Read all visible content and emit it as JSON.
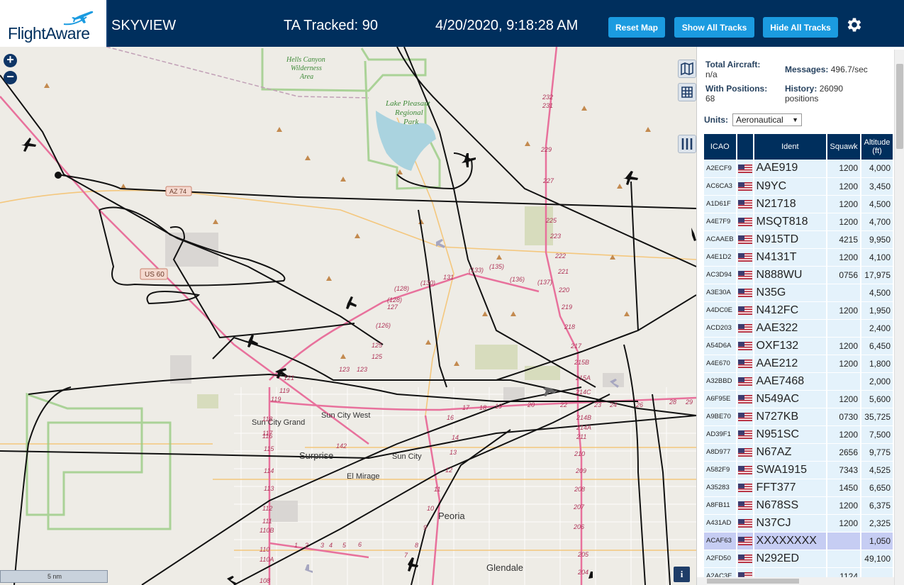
{
  "header": {
    "logo_text": "FlightAware",
    "site_name": "SKYVIEW",
    "tracked": "TA Tracked: 90",
    "datetime": "4/20/2020, 9:18:28 AM",
    "buttons": {
      "reset": "Reset Map",
      "show_all": "Show All Tracks",
      "hide_all": "Hide All Tracks"
    },
    "settings_icon": "gear-icon"
  },
  "map": {
    "zoom_in": "+",
    "zoom_out": "−",
    "scale_label": "5 nm",
    "info_label": "i",
    "places": {
      "hells_canyon": "Hells Canyon",
      "wilderness": "Wilderness",
      "area": "Area",
      "lake_pleasant": "Lake Pleasant",
      "regional": "Regional",
      "park": "Park",
      "sun_city_west": "Sun City West",
      "sun_city_grand": "Sun City Grand",
      "surprise": "Surprise",
      "sun_city": "Sun City",
      "el_mirage": "El Mirage",
      "peoria": "Peoria",
      "glendale": "Glendale"
    },
    "road_shields": {
      "az74": "AZ 74",
      "us60": "US 60"
    },
    "exits": {
      "i17": [
        "232",
        "231",
        "229",
        "227",
        "225",
        "223",
        "222",
        "221",
        "220",
        "219",
        "218",
        "217",
        "215B",
        "215A",
        "214C",
        "214B",
        "214A",
        "211",
        "210",
        "209",
        "208",
        "207",
        "206",
        "205",
        "204"
      ],
      "loop303": [
        "(128)",
        "(130)",
        "131",
        "(133)",
        "(135)",
        "(136)",
        "(137)",
        "(128)",
        "127",
        "(126)",
        "125",
        "125",
        "123",
        "123",
        "121",
        "119",
        "119",
        "118",
        "117",
        "116",
        "115",
        "114",
        "113",
        "112",
        "111",
        "110B",
        "110",
        "110A",
        "108",
        "17",
        "18",
        "19",
        "20",
        "22",
        "23",
        "24",
        "26",
        "28",
        "29",
        "142",
        "16",
        "14",
        "13",
        "12",
        "11",
        "10",
        "9",
        "8",
        "7",
        "6",
        "5",
        "4",
        "3",
        "2",
        "1"
      ]
    },
    "tools": [
      "map-layers-icon",
      "grid-icon",
      "columns-icon"
    ]
  },
  "sidebar": {
    "total_aircraft_label": "Total Aircraft:",
    "total_aircraft_value": "n/a",
    "with_positions_label": "With Positions:",
    "with_positions_value": "68",
    "messages_label": "Messages:",
    "messages_value": "496.7/sec",
    "history_label": "History:",
    "history_value": "26090",
    "history_unit": "positions",
    "units_label": "Units:",
    "units_value": "Aeronautical",
    "columns": {
      "icao": "ICAO",
      "flag": "",
      "ident": "Ident",
      "squawk": "Squawk",
      "altitude": "Altitude",
      "altitude_unit": "(ft)"
    },
    "rows": [
      {
        "icao": "A2ECF9",
        "ident": "AAE919",
        "squawk": "1200",
        "alt": "4,000"
      },
      {
        "icao": "AC6CA3",
        "ident": "N9YC",
        "squawk": "1200",
        "alt": "3,450"
      },
      {
        "icao": "A1D61F",
        "ident": "N21718",
        "squawk": "1200",
        "alt": "4,500"
      },
      {
        "icao": "A4E7F9",
        "ident": "MSQT818",
        "squawk": "1200",
        "alt": "4,700"
      },
      {
        "icao": "ACAAEB",
        "ident": "N915TD",
        "squawk": "4215",
        "alt": "9,950"
      },
      {
        "icao": "A4E1D2",
        "ident": "N4131T",
        "squawk": "1200",
        "alt": "4,100"
      },
      {
        "icao": "AC3D94",
        "ident": "N888WU",
        "squawk": "0756",
        "alt": "17,975"
      },
      {
        "icao": "A3E30A",
        "ident": "N35G",
        "squawk": "",
        "alt": "4,500"
      },
      {
        "icao": "A4DC0E",
        "ident": "N412FC",
        "squawk": "1200",
        "alt": "1,950"
      },
      {
        "icao": "ACD203",
        "ident": "AAE322",
        "squawk": "",
        "alt": "2,400"
      },
      {
        "icao": "A54D6A",
        "ident": "OXF132",
        "squawk": "1200",
        "alt": "6,450"
      },
      {
        "icao": "A4E670",
        "ident": "AAE212",
        "squawk": "1200",
        "alt": "1,800"
      },
      {
        "icao": "A32BBD",
        "ident": "AAE7468",
        "squawk": "",
        "alt": "2,000"
      },
      {
        "icao": "A6F95E",
        "ident": "N549AC",
        "squawk": "1200",
        "alt": "5,600"
      },
      {
        "icao": "A9BE70",
        "ident": "N727KB",
        "squawk": "0730",
        "alt": "35,725"
      },
      {
        "icao": "AD39F1",
        "ident": "N951SC",
        "squawk": "1200",
        "alt": "7,500"
      },
      {
        "icao": "A8D977",
        "ident": "N67AZ",
        "squawk": "2656",
        "alt": "9,775"
      },
      {
        "icao": "A582F9",
        "ident": "SWA1915",
        "squawk": "7343",
        "alt": "4,525"
      },
      {
        "icao": "A35283",
        "ident": "FFT377",
        "squawk": "1450",
        "alt": "6,650"
      },
      {
        "icao": "A8FB11",
        "ident": "N678SS",
        "squawk": "1200",
        "alt": "6,375"
      },
      {
        "icao": "A431AD",
        "ident": "N37CJ",
        "squawk": "1200",
        "alt": "2,325"
      },
      {
        "icao": "ACAF63",
        "ident": "XXXXXXXX",
        "squawk": "",
        "alt": "1,050",
        "selected": true
      },
      {
        "icao": "A2FD50",
        "ident": "N292ED",
        "squawk": "",
        "alt": "49,100"
      },
      {
        "icao": "A2AC3E",
        "ident": "",
        "squawk": "1124",
        "alt": ""
      }
    ]
  },
  "colors": {
    "header_bg": "#002f5d",
    "button": "#1b9be0",
    "row_bg": "#e4f2fb",
    "selected_row": "#c6cdf3",
    "highway": "#e8719c"
  }
}
